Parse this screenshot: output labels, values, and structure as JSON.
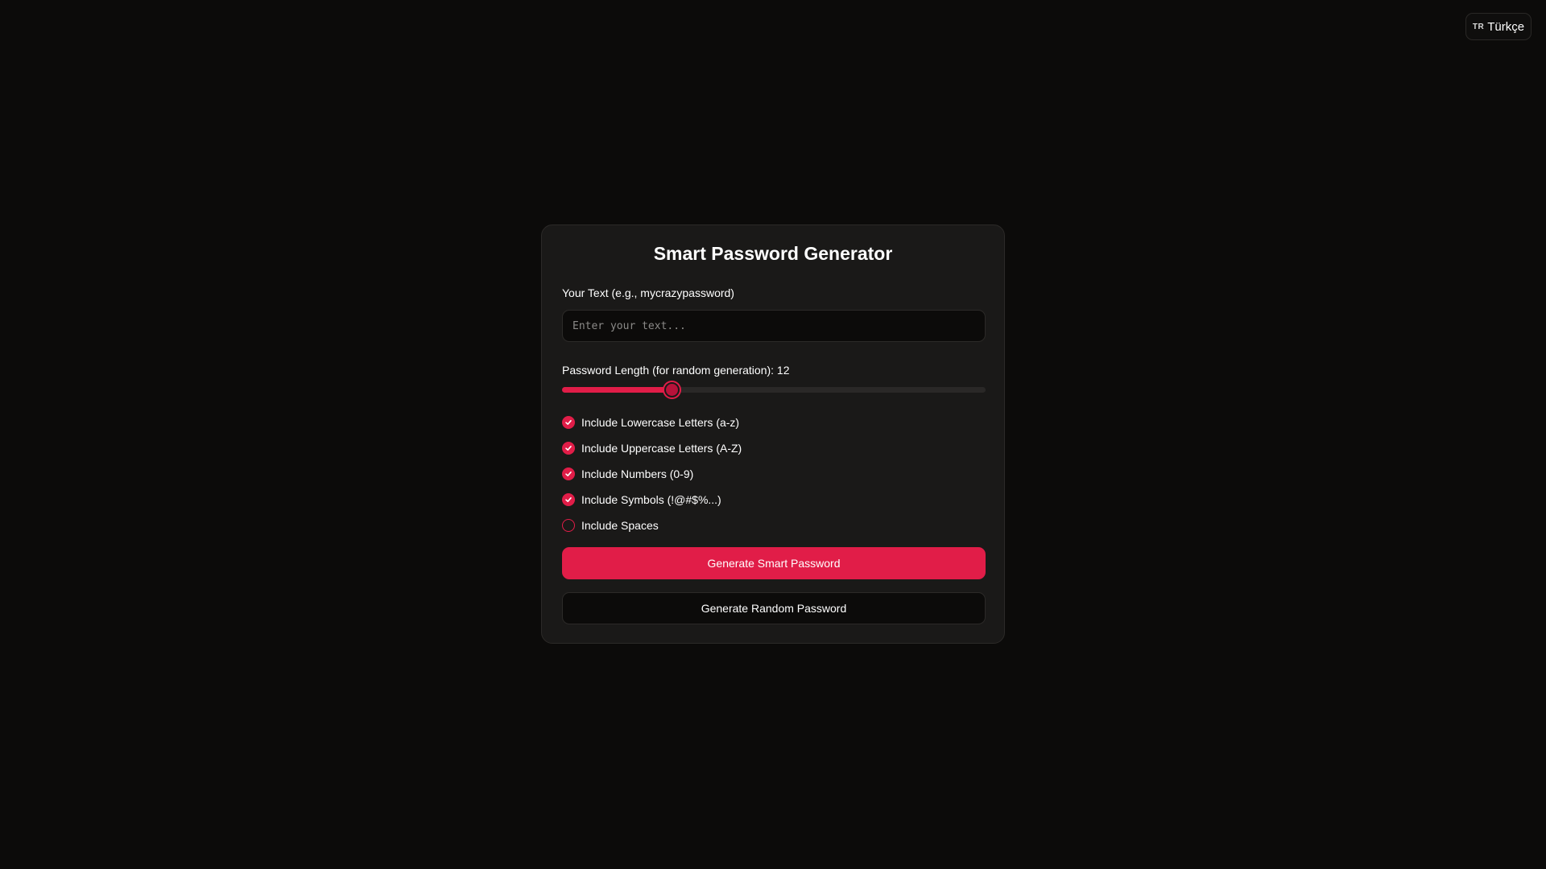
{
  "language_button": {
    "code": "TR",
    "label": "Türkçe"
  },
  "app": {
    "title": "Smart Password Generator"
  },
  "text_field": {
    "label": "Your Text (e.g., mycrazypassword)",
    "placeholder": "Enter your text...",
    "value": ""
  },
  "length": {
    "label": "Password Length (for random generation): 12",
    "value": 12,
    "min": 4,
    "max": 35
  },
  "options": [
    {
      "label": "Include Lowercase Letters (a-z)",
      "checked": true
    },
    {
      "label": "Include Uppercase Letters (A-Z)",
      "checked": true
    },
    {
      "label": "Include Numbers (0-9)",
      "checked": true
    },
    {
      "label": "Include Symbols (!@#$%...)",
      "checked": true
    },
    {
      "label": "Include Spaces",
      "checked": false
    }
  ],
  "buttons": {
    "smart": "Generate Smart Password",
    "random": "Generate Random Password"
  },
  "colors": {
    "accent": "#e11d48",
    "background": "#0c0b0a",
    "card": "#1a1918"
  }
}
